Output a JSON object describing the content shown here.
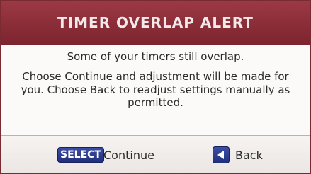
{
  "dialog": {
    "title": "TIMER OVERLAP ALERT",
    "message_line1": "Some of your timers still overlap.",
    "message_para": "Choose Continue and adjustment will be made for you. Choose Back to readjust settings manually as permitted."
  },
  "footer": {
    "select_badge": "SELECT",
    "continue_label": "Continue",
    "back_icon": "left-arrow-icon",
    "back_label": "Back"
  },
  "colors": {
    "header_bg": "#8e2f3a",
    "header_text": "#f4e9ea",
    "button_blue": "#2a3a8f"
  }
}
